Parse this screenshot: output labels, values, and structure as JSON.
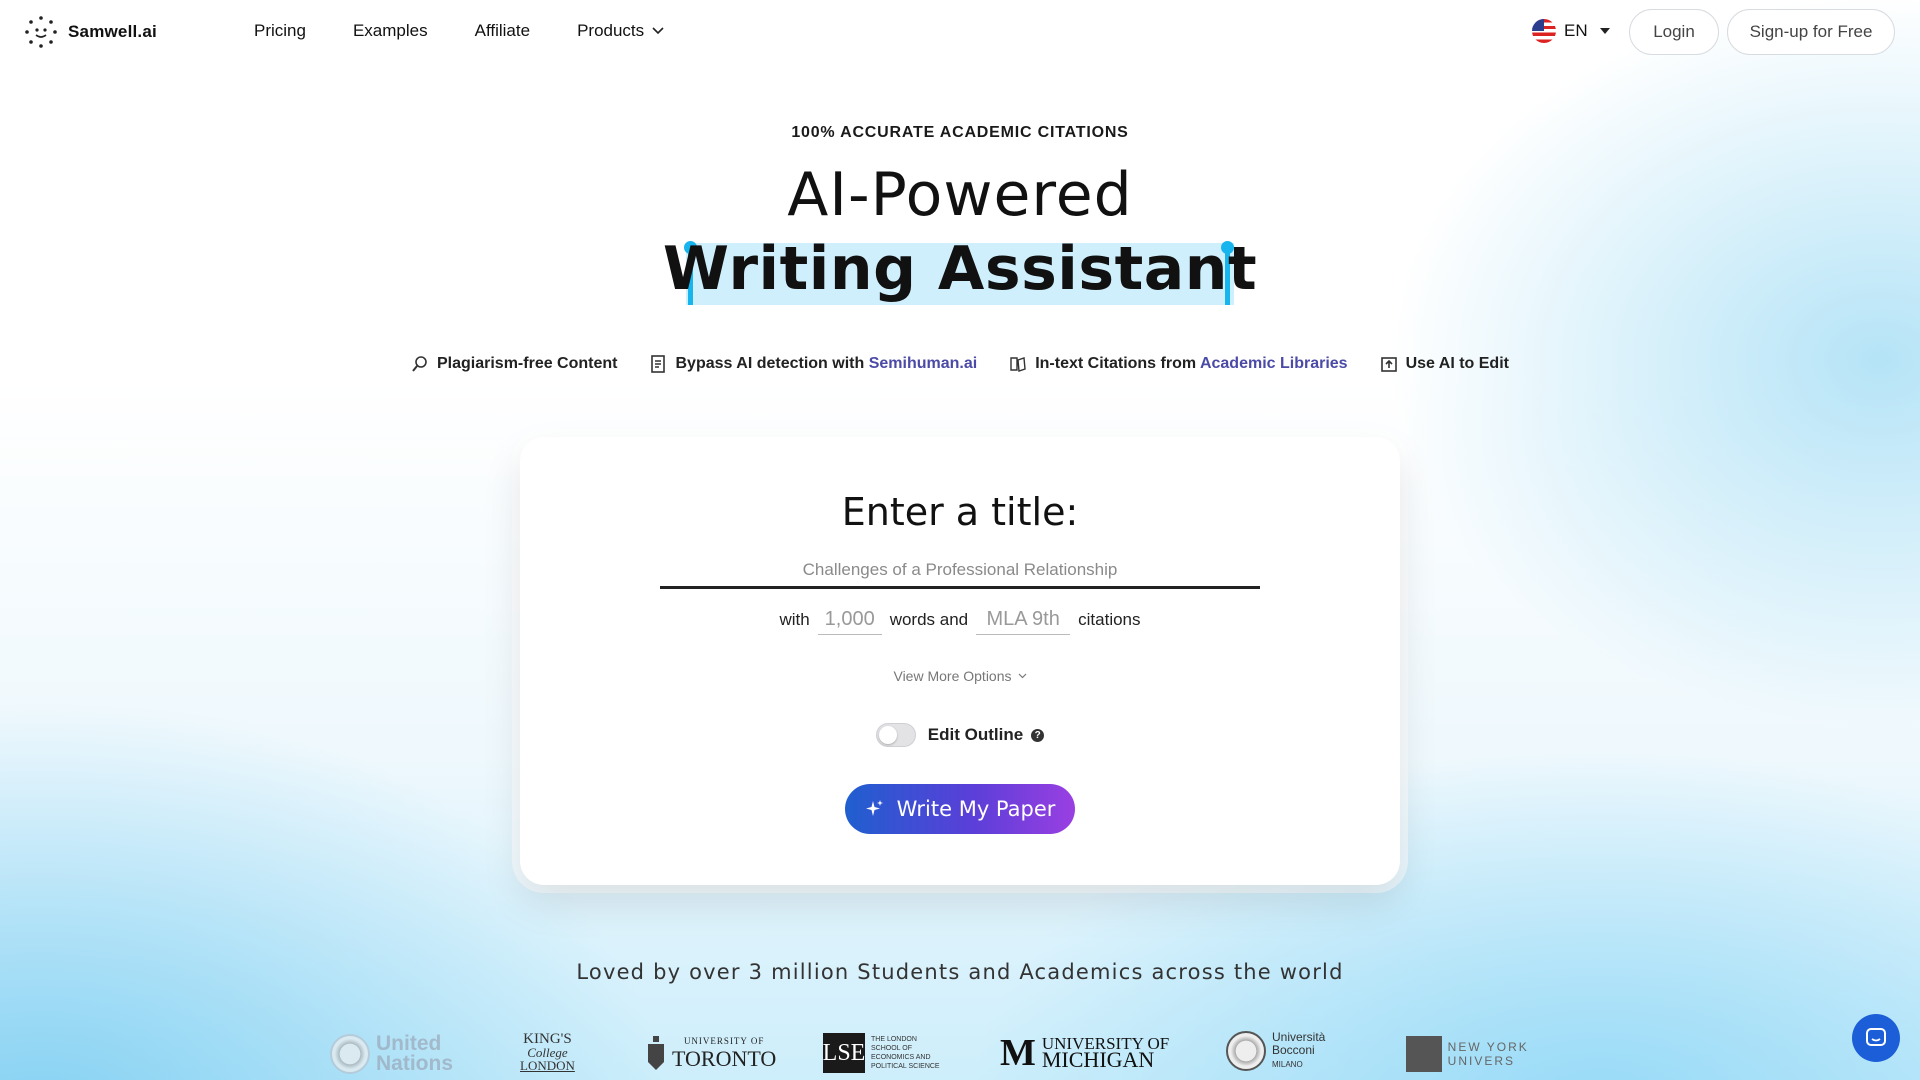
{
  "brand": {
    "name": "Samwell.ai"
  },
  "nav": {
    "items": [
      "Pricing",
      "Examples",
      "Affiliate"
    ],
    "products_label": "Products",
    "language": "EN",
    "login_label": "Login",
    "signup_label": "Sign-up for Free"
  },
  "hero": {
    "eyebrow": "100% ACCURATE ACADEMIC CITATIONS",
    "title_line1": "AI-Powered",
    "title_line2": "Writing Assistant"
  },
  "features": [
    {
      "icon": "plagiarism-icon",
      "text": "Plagiarism-free Content",
      "link": ""
    },
    {
      "icon": "document-check-icon",
      "text": "Bypass AI detection with ",
      "link": "Semihuman.ai"
    },
    {
      "icon": "library-icon",
      "text": "In-text Citations from ",
      "link": "Academic Libraries"
    },
    {
      "icon": "ai-edit-icon",
      "text": "Use AI to Edit",
      "link": ""
    }
  ],
  "form": {
    "heading": "Enter a title:",
    "title_placeholder": "Challenges of a Professional Relationship",
    "with_label": "with",
    "words_placeholder": "1,000",
    "words_label": "words and",
    "citation_placeholder": "MLA 9th",
    "citations_label": "citations",
    "more_options": "View More Options",
    "edit_outline_label": "Edit Outline",
    "edit_outline_on": false,
    "submit_label": "Write My Paper"
  },
  "trust": {
    "headline": "Loved by over 3 million Students and Academics across the world",
    "logos": {
      "un_1": "United",
      "un_2": "Nations",
      "kcl_1": "KING'S",
      "kcl_2": "College",
      "kcl_3": "LONDON",
      "uoft_small": "UNIVERSITY OF",
      "uoft": "TORONTO",
      "lse": "LSE",
      "lse_txt": "THE LONDON SCHOOL OF ECONOMICS AND POLITICAL SCIENCE",
      "umich_1": "UNIVERSITY OF",
      "umich_2": "MICHIGAN",
      "bocconi_1": "Università",
      "bocconi_2": "Bocconi",
      "bocconi_3": "MILANO",
      "nyu": "NEW YORK UNIVERS"
    }
  },
  "colors": {
    "accent": "#4b4aa6",
    "highlight": "#cfeffd",
    "cursor": "#18b4ee",
    "chat": "#1b5ed8"
  }
}
